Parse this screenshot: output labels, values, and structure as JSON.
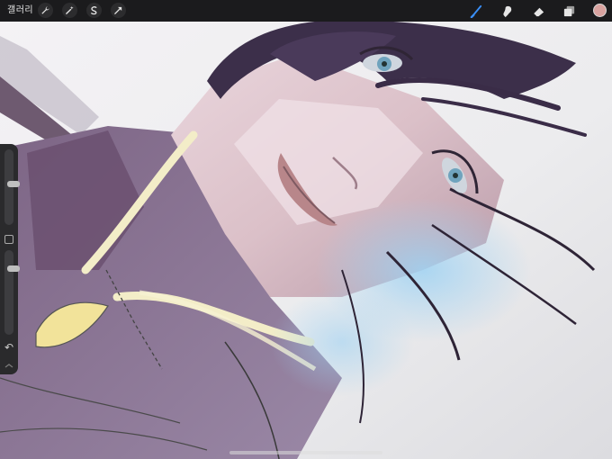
{
  "toolbar": {
    "gallery_label": "갤러리",
    "left_tools": [
      "wrench-icon",
      "magic-wand-icon",
      "selection-icon",
      "transform-arrow-icon"
    ],
    "right_tools": [
      "brush-icon",
      "smudge-icon",
      "eraser-icon",
      "layers-icon"
    ],
    "active_tool": "brush-icon",
    "active_tool_color": "#3a8ef5",
    "current_color": "#d9a3a0"
  },
  "sidebar": {
    "brush_size_level": 0.55,
    "opacity_level": 0.2
  }
}
